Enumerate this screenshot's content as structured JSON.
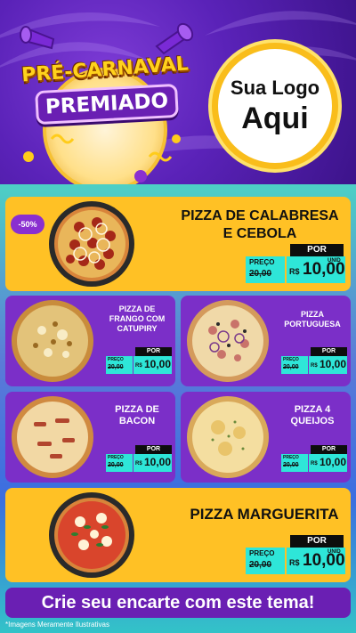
{
  "header": {
    "title_line1": "PRÉ-CARNAVAL",
    "title_line2": "PREMIADO",
    "logo_line1": "Sua Logo",
    "logo_line2": "Aqui"
  },
  "discount_badge": "-50%",
  "common": {
    "por": "POR",
    "preco": "PREÇO",
    "unid": "UNID",
    "currency": "R$",
    "old_price": "20,00",
    "new_price": "10,00"
  },
  "products": [
    {
      "name_line1": "PIZZA DE CALABRESA",
      "name_line2": "E CEBOLA"
    },
    {
      "name_line1": "PIZZA DE",
      "name_line2": "FRANGO COM",
      "name_line3": "CATUPIRY"
    },
    {
      "name_line1": "PIZZA",
      "name_line2": "PORTUGUESA"
    },
    {
      "name_line1": "PIZZA DE",
      "name_line2": "BACON"
    },
    {
      "name_line1": "PIZZA 4",
      "name_line2": "QUEIJOS"
    },
    {
      "name_line1": "PIZZA MARGUERITA"
    }
  ],
  "footer": {
    "banner": "Crie seu encarte com este tema!",
    "disclaimer": "*Imagens Meramente Ilustrativas"
  },
  "colors": {
    "header_bg": "#5a22b8",
    "yellow_card": "#ffc125",
    "purple_card": "#7b2fc8",
    "price_teal": "#2ee6d8",
    "logo_ring": "#f9bd1b"
  }
}
